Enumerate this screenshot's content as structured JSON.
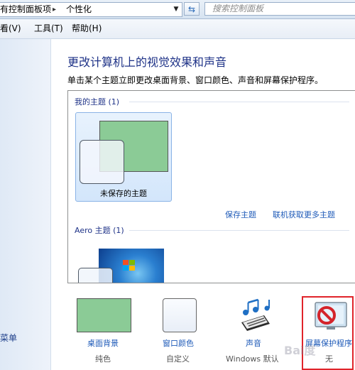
{
  "address_bar": {
    "crumbs": [
      "有控制面板项",
      "个性化"
    ],
    "search_placeholder": "搜索控制面板"
  },
  "menu": [
    "看(V)",
    "工具(T)",
    "帮助(H)"
  ],
  "leftnav": {
    "link": "菜单"
  },
  "main": {
    "title": "更改计算机上的视觉效果和声音",
    "description": "单击某个主题立即更改桌面背景、窗口颜色、声音和屏幕保护程序。"
  },
  "themes": {
    "my_group": "我的主题 (1)",
    "unsaved_label": "未保存的主题",
    "save_link": "保存主题",
    "online_link": "联机获取更多主题",
    "aero_group": "Aero 主题 (1)"
  },
  "bottom": {
    "desktop_bg": {
      "label": "桌面背景",
      "value": "纯色"
    },
    "window_color": {
      "label": "窗口颜色",
      "value": "自定义"
    },
    "sound": {
      "label": "声音",
      "value": "Windows 默认"
    },
    "screensaver": {
      "label": "屏幕保护程序",
      "value": "无"
    }
  },
  "colors": {
    "accent_text": "#1e3287",
    "link": "#1e5ab8",
    "highlight": "#e0242a"
  },
  "watermark": "Bai度"
}
